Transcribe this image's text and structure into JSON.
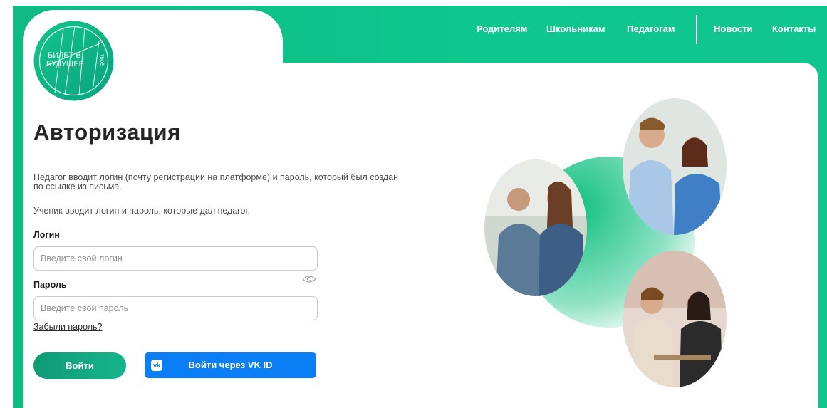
{
  "nav": {
    "items": [
      "Родителям",
      "Школьникам",
      "Педагогам",
      "Новости",
      "Контакты"
    ]
  },
  "logo": {
    "line1": "БИЛЕТ В",
    "line2": "БУДУЩЕЕ",
    "vertical": "ТВОЁ"
  },
  "auth": {
    "title": "Авторизация",
    "desc1": "Педагог вводит логин (почту регистрации на платформе) и пароль, который был создан по ссылке из письма.",
    "desc2": "Ученик вводит логин и пароль, которые дал педагог.",
    "login_label": "Логин",
    "login_placeholder": "Введите свой логин",
    "password_label": "Пароль",
    "password_placeholder": "Введите свой пароль",
    "forgot": "Забыли пароль?",
    "login_button": "Войти",
    "vk_button": "Войти через VK ID",
    "vk_icon_text": "vk"
  },
  "colors": {
    "brand_green": "#0fba83",
    "login_button": "#0e9b76",
    "vk_blue": "#0a7ef5"
  },
  "icons": [
    "logo-emblem",
    "eye-icon",
    "vk-icon"
  ]
}
